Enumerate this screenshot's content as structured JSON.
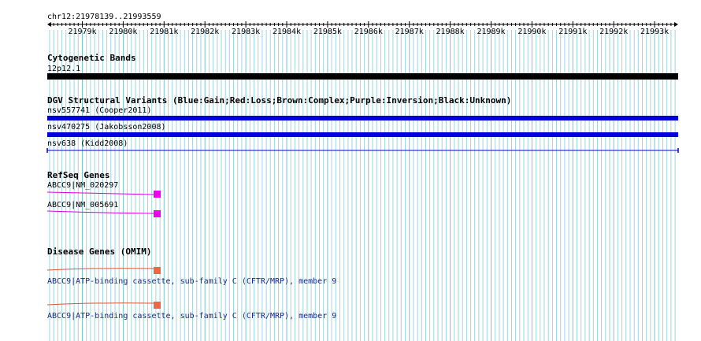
{
  "ruler": {
    "region": "chr12:21978139..21993559",
    "ticks": [
      "21979k",
      "21980k",
      "21981k",
      "21982k",
      "21983k",
      "21984k",
      "21985k",
      "21986k",
      "21987k",
      "21988k",
      "21989k",
      "21990k",
      "21991k",
      "21992k",
      "21993k"
    ]
  },
  "cytoband": {
    "title": "Cytogenetic Bands",
    "band_label": "12p12.1",
    "color": "#000000"
  },
  "dgv": {
    "title": "DGV Structural Variants (Blue:Gain;Red:Loss;Brown:Complex;Purple:Inversion;Black:Unknown)",
    "variants": [
      {
        "label": "nsv557741 (Cooper2011)",
        "color": "#0000dd"
      },
      {
        "label": "nsv470275 (Jakobsson2008)",
        "color": "#0000dd"
      },
      {
        "label": "nsv638 (Kidd2008)",
        "color": "#0000dd"
      }
    ]
  },
  "refseq": {
    "title": "RefSeq Genes",
    "genes": [
      {
        "label": "ABCC9|NM_020297",
        "color": "#ee00ee"
      },
      {
        "label": "ABCC9|NM_005691",
        "color": "#ee00ee"
      }
    ]
  },
  "omim": {
    "title": "Disease Genes (OMIM)",
    "genes": [
      {
        "label": "ABCC9|ATP-binding cassette, sub-family C (CFTR/MRP), member 9",
        "color": "#ee6644"
      },
      {
        "label": "ABCC9|ATP-binding cassette, sub-family C (CFTR/MRP), member 9",
        "color": "#ee6644"
      }
    ]
  },
  "colors": {
    "grid_line": "#9fd6df",
    "grid_major": "#7cc4d0"
  }
}
